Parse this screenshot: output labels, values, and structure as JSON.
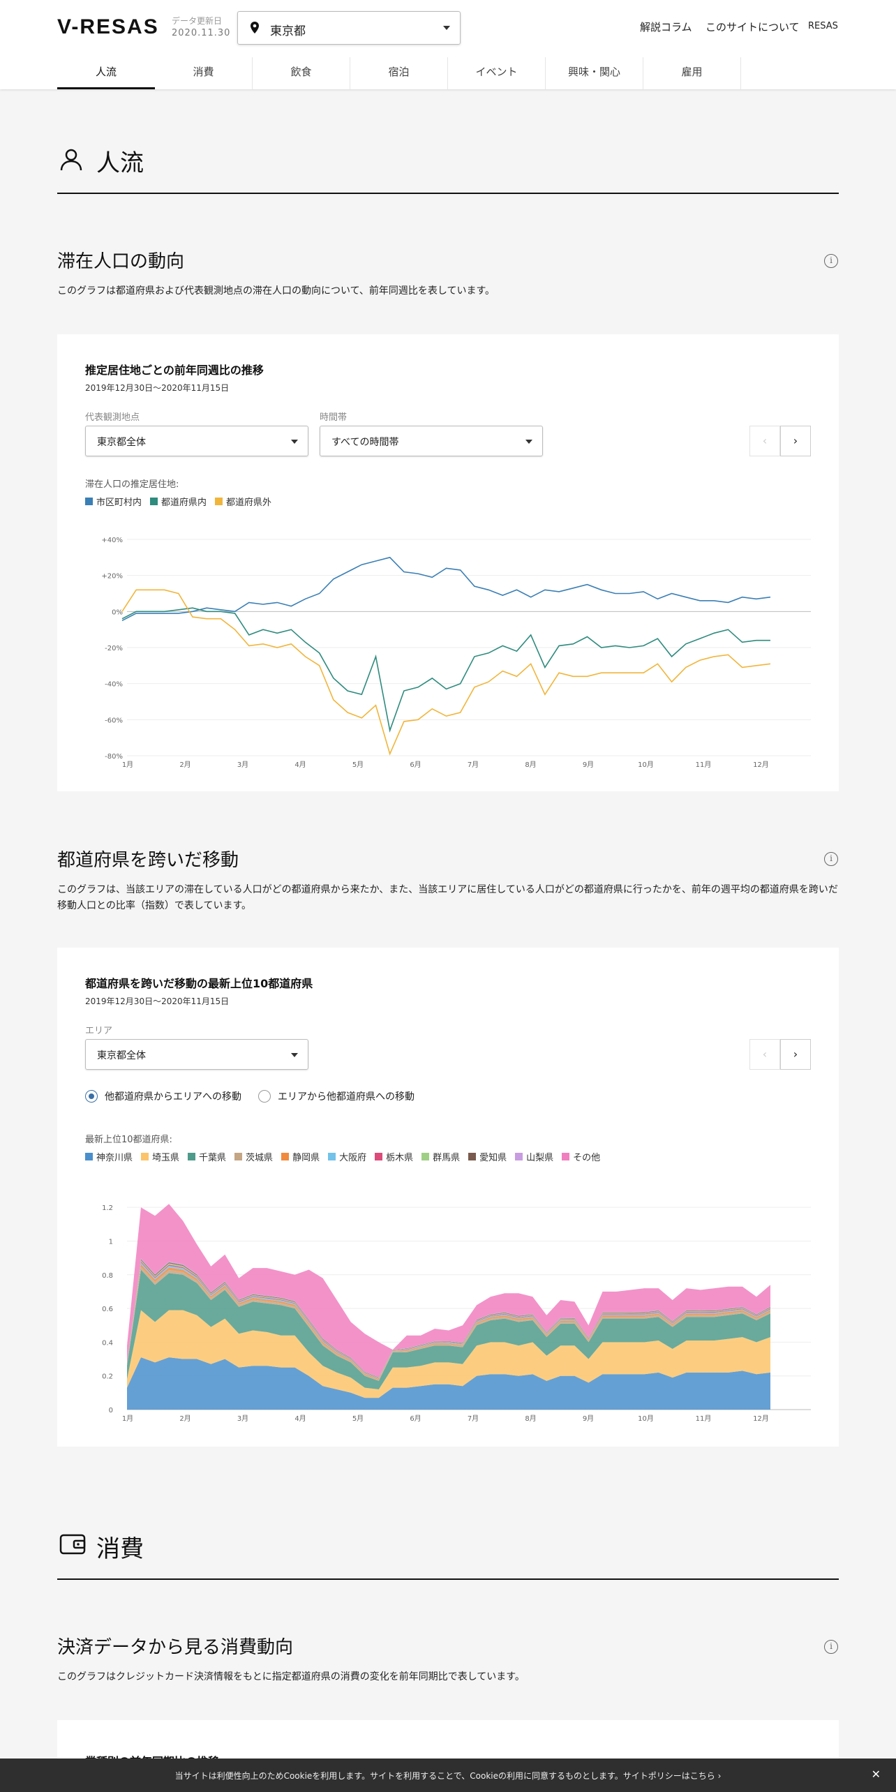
{
  "header": {
    "logo": "V-RESAS",
    "updated_label": "データ更新日",
    "updated_date": "2020.11.30",
    "prefecture": "東京都",
    "nav": [
      "解説コラム",
      "このサイトについて",
      "RESAS"
    ]
  },
  "tabs": [
    "人流",
    "消費",
    "飲食",
    "宿泊",
    "イベント",
    "興味・関心",
    "雇用"
  ],
  "section1": {
    "title": "人流",
    "icon": "person-icon"
  },
  "block1": {
    "title": "滞在人口の動向",
    "description": "このグラフは都道府県および代表観測地点の滞在人口の動向について、前年同週比を表しています。",
    "card_title": "推定居住地ごとの前年同週比の推移",
    "date_range": "2019年12月30日〜2020年11月15日",
    "select1_label": "代表観測地点",
    "select1_value": "東京都全体",
    "select2_label": "時間帯",
    "select2_value": "すべての時間帯",
    "legend_title": "滞在人口の推定居住地:"
  },
  "block2": {
    "title": "都道府県を跨いだ移動",
    "description": "このグラフは、当該エリアの滞在している人口がどの都道府県から来たか、また、当該エリアに居住している人口がどの都道府県に行ったかを、前年の週平均の都道府県を跨いだ移動人口との比率（指数）で表しています。",
    "card_title": "都道府県を跨いだ移動の最新上位10都道府県",
    "date_range": "2019年12月30日〜2020年11月15日",
    "select_label": "エリア",
    "select_value": "東京都全体",
    "radio1": "他都道府県からエリアへの移動",
    "radio2": "エリアから他都道府県への移動",
    "legend_title": "最新上位10都道府県:"
  },
  "section2": {
    "title": "消費",
    "icon": "wallet-icon"
  },
  "block3": {
    "title": "決済データから見る消費動向",
    "description": "このグラフはクレジットカード決済情報をもとに指定都道府県の消費の変化を前年同期比で表しています。",
    "card_title": "業種別の前年同期比の推移"
  },
  "cookie": {
    "text": "当サイトは利便性向上のためCookieを利用します。サイトを利用することで、Cookieの利用に同意するものとします。サイトポリシーはこちら ›",
    "close": "✕"
  },
  "chart_data": [
    {
      "type": "line",
      "x": [
        "12/30",
        "1/6",
        "1/13",
        "1/20",
        "1/27",
        "2/3",
        "2/10",
        "2/17",
        "2/24",
        "3/2",
        "3/9",
        "3/16",
        "3/23",
        "3/30",
        "4/6",
        "4/13",
        "4/20",
        "4/27",
        "5/4",
        "5/11",
        "5/18",
        "5/25",
        "6/1",
        "6/8",
        "6/15",
        "6/22",
        "6/29",
        "7/6",
        "7/13",
        "7/20",
        "7/27",
        "8/3",
        "8/10",
        "8/17",
        "8/24",
        "8/31",
        "9/7",
        "9/14",
        "9/21",
        "9/28",
        "10/5",
        "10/12",
        "10/19",
        "10/26",
        "11/2",
        "11/9",
        "11/15"
      ],
      "xticks": [
        "1月",
        "2月",
        "3月",
        "4月",
        "5月",
        "6月",
        "7月",
        "8月",
        "9月",
        "10月",
        "11月",
        "12月"
      ],
      "yticks": [
        "+40%",
        "+20%",
        "0%",
        "-20%",
        "-40%",
        "-60%",
        "-80%"
      ],
      "ylim": [
        -80,
        40
      ],
      "series": [
        {
          "name": "市区町村内",
          "color": "#3a7fb5",
          "values": [
            -5,
            -1,
            -1,
            -1,
            -1,
            0,
            2,
            1,
            0,
            5,
            4,
            5,
            3,
            7,
            10,
            18,
            22,
            26,
            28,
            30,
            22,
            21,
            19,
            24,
            23,
            14,
            12,
            9,
            12,
            8,
            12,
            11,
            13,
            15,
            12,
            10,
            10,
            11,
            7,
            10,
            8,
            6,
            6,
            5,
            8,
            7,
            8
          ]
        },
        {
          "name": "都道府県内",
          "color": "#2e8b7e",
          "values": [
            -4,
            0,
            0,
            0,
            1,
            2,
            0,
            0,
            -1,
            -13,
            -10,
            -12,
            -10,
            -17,
            -23,
            -37,
            -44,
            -46,
            -25,
            -66,
            -44,
            -42,
            -37,
            -43,
            -40,
            -25,
            -23,
            -19,
            -22,
            -13,
            -31,
            -19,
            -18,
            -14,
            -20,
            -19,
            -20,
            -19,
            -15,
            -25,
            -18,
            -15,
            -12,
            -10,
            -17,
            -16,
            -16
          ]
        },
        {
          "name": "都道府県外",
          "color": "#f1b53b",
          "values": [
            0,
            12,
            12,
            12,
            10,
            -3,
            -4,
            -4,
            -10,
            -19,
            -18,
            -20,
            -18,
            -25,
            -30,
            -49,
            -56,
            -59,
            -52,
            -79,
            -61,
            -60,
            -54,
            -58,
            -56,
            -42,
            -39,
            -33,
            -36,
            -29,
            -46,
            -34,
            -36,
            -36,
            -34,
            -34,
            -34,
            -34,
            -29,
            -39,
            -31,
            -27,
            -25,
            -24,
            -31,
            -30,
            -29
          ]
        }
      ]
    },
    {
      "type": "area",
      "stacked": true,
      "xticks": [
        "1月",
        "2月",
        "3月",
        "4月",
        "5月",
        "6月",
        "7月",
        "8月",
        "9月",
        "10月",
        "11月",
        "12月"
      ],
      "yticks": [
        "0",
        "0.2",
        "0.4",
        "0.6",
        "0.8",
        "1",
        "1.2"
      ],
      "ylim": [
        0,
        1.3
      ],
      "series": [
        {
          "name": "神奈川県",
          "color": "#4a8fcc"
        },
        {
          "name": "埼玉県",
          "color": "#fbc46a"
        },
        {
          "name": "千葉県",
          "color": "#4f9b8b"
        },
        {
          "name": "茨城県",
          "color": "#c4a584"
        },
        {
          "name": "静岡県",
          "color": "#f08a3c"
        },
        {
          "name": "大阪府",
          "color": "#73c2ea"
        },
        {
          "name": "栃木県",
          "color": "#dc4b7a"
        },
        {
          "name": "群馬県",
          "color": "#9fcf84"
        },
        {
          "name": "愛知県",
          "color": "#7a5a4e"
        },
        {
          "name": "山梨県",
          "color": "#c89ce0"
        },
        {
          "name": "その他",
          "color": "#f17fbf"
        }
      ],
      "total": [
        0.38,
        1.2,
        1.15,
        1.22,
        1.12,
        0.98,
        0.85,
        0.92,
        0.78,
        0.84,
        0.84,
        0.82,
        0.8,
        0.83,
        0.78,
        0.65,
        0.52,
        0.45,
        0.4,
        0.28,
        0.44,
        0.44,
        0.48,
        0.47,
        0.5,
        0.62,
        0.67,
        0.69,
        0.69,
        0.67,
        0.56,
        0.65,
        0.64,
        0.5,
        0.7,
        0.7,
        0.71,
        0.72,
        0.72,
        0.65,
        0.72,
        0.71,
        0.72,
        0.73,
        0.73,
        0.67,
        0.74
      ],
      "layers": {
        "神奈川県": [
          0.13,
          0.31,
          0.28,
          0.31,
          0.3,
          0.3,
          0.27,
          0.3,
          0.25,
          0.26,
          0.26,
          0.25,
          0.25,
          0.2,
          0.14,
          0.12,
          0.1,
          0.07,
          0.07,
          0.13,
          0.13,
          0.14,
          0.15,
          0.15,
          0.14,
          0.2,
          0.21,
          0.21,
          0.2,
          0.21,
          0.17,
          0.2,
          0.2,
          0.16,
          0.21,
          0.21,
          0.21,
          0.21,
          0.22,
          0.19,
          0.22,
          0.22,
          0.22,
          0.22,
          0.23,
          0.21,
          0.22
        ],
        "埼玉県": [
          0.05,
          0.28,
          0.24,
          0.28,
          0.29,
          0.26,
          0.22,
          0.24,
          0.2,
          0.21,
          0.2,
          0.19,
          0.19,
          0.14,
          0.12,
          0.1,
          0.09,
          0.06,
          0.05,
          0.12,
          0.12,
          0.12,
          0.13,
          0.13,
          0.13,
          0.18,
          0.19,
          0.19,
          0.18,
          0.19,
          0.15,
          0.18,
          0.18,
          0.14,
          0.19,
          0.19,
          0.19,
          0.19,
          0.19,
          0.17,
          0.19,
          0.19,
          0.19,
          0.2,
          0.2,
          0.19,
          0.21
        ],
        "千葉県": [
          0.08,
          0.24,
          0.22,
          0.22,
          0.21,
          0.19,
          0.16,
          0.17,
          0.16,
          0.17,
          0.17,
          0.18,
          0.16,
          0.15,
          0.12,
          0.1,
          0.09,
          0.07,
          0.05,
          0.09,
          0.09,
          0.1,
          0.1,
          0.1,
          0.1,
          0.12,
          0.13,
          0.14,
          0.14,
          0.13,
          0.11,
          0.13,
          0.13,
          0.1,
          0.14,
          0.14,
          0.14,
          0.14,
          0.14,
          0.13,
          0.14,
          0.14,
          0.14,
          0.14,
          0.14,
          0.13,
          0.14
        ]
      }
    }
  ]
}
